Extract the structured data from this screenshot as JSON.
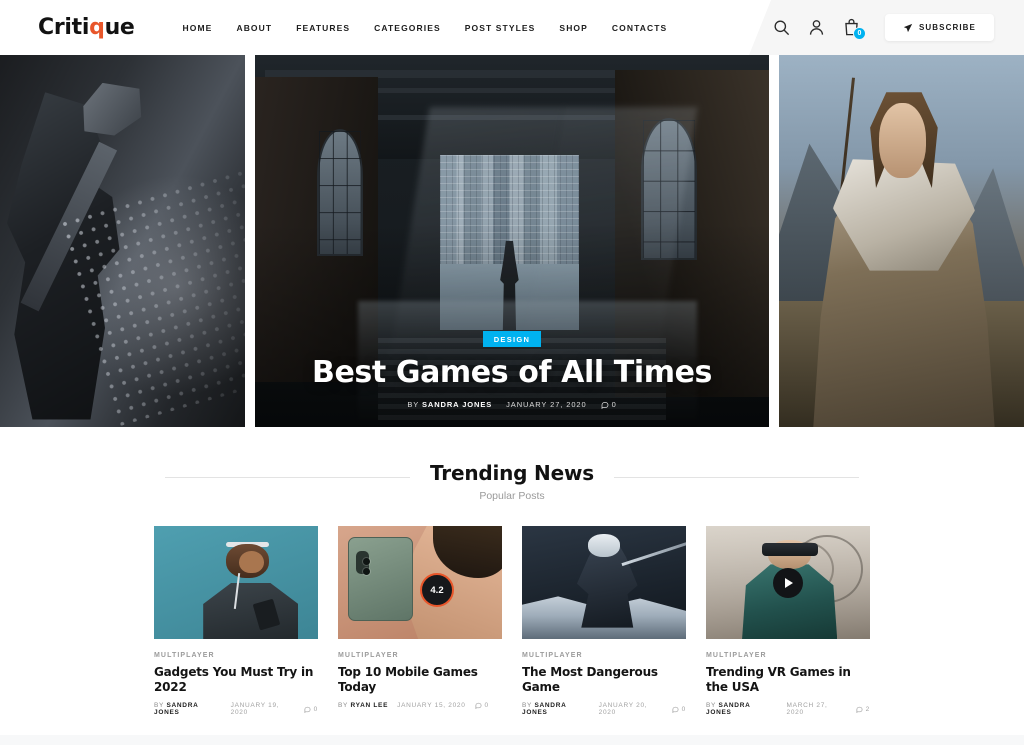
{
  "site": {
    "logo_text": "Critique",
    "logo_accent_letter": "q"
  },
  "nav": {
    "items": [
      {
        "label": "HOME"
      },
      {
        "label": "ABOUT"
      },
      {
        "label": "FEATURES"
      },
      {
        "label": "CATEGORIES"
      },
      {
        "label": "POST STYLES"
      },
      {
        "label": "SHOP"
      },
      {
        "label": "CONTACTS"
      }
    ]
  },
  "header_actions": {
    "search_icon": "search-icon",
    "account_icon": "user-icon",
    "cart_icon": "cart-bag-icon",
    "cart_count": "0",
    "subscribe_label": "SUBSCRIBE",
    "subscribe_icon": "paper-plane-icon"
  },
  "hero": {
    "main_slide": {
      "category": "DESIGN",
      "title": "Best Games of All Times",
      "author_prefix": "BY",
      "author": "SANDRA JONES",
      "date": "JANUARY 27, 2020",
      "comments": "0"
    }
  },
  "trending": {
    "title": "Trending News",
    "subtitle": "Popular Posts",
    "cards": [
      {
        "category": "MULTIPLAYER",
        "title": "Gadgets You Must Try in 2022",
        "author_prefix": "BY",
        "author": "SANDRA JONES",
        "date": "JANUARY 19, 2020",
        "comments": "0"
      },
      {
        "category": "MULTIPLAYER",
        "title": "Top 10 Mobile Games Today",
        "author_prefix": "BY",
        "author": "RYAN LEE",
        "date": "JANUARY 15, 2020",
        "comments": "0",
        "rating": "4.2"
      },
      {
        "category": "MULTIPLAYER",
        "title": "The Most Dangerous Game",
        "author_prefix": "BY",
        "author": "SANDRA JONES",
        "date": "JANUARY 20, 2020",
        "comments": "0"
      },
      {
        "category": "MULTIPLAYER",
        "title": "Trending VR Games in the USA",
        "author_prefix": "BY",
        "author": "SANDRA JONES",
        "date": "MARCH 27, 2020",
        "comments": "2",
        "has_video": true
      }
    ],
    "pagination": {
      "total": 7,
      "active_index": 1
    }
  },
  "colors": {
    "accent_orange": "#e8562a",
    "accent_cyan": "#00b2f0",
    "text_dark": "#121212",
    "text_muted": "#9a9a9a",
    "header_panel": "#f6f6f6"
  }
}
